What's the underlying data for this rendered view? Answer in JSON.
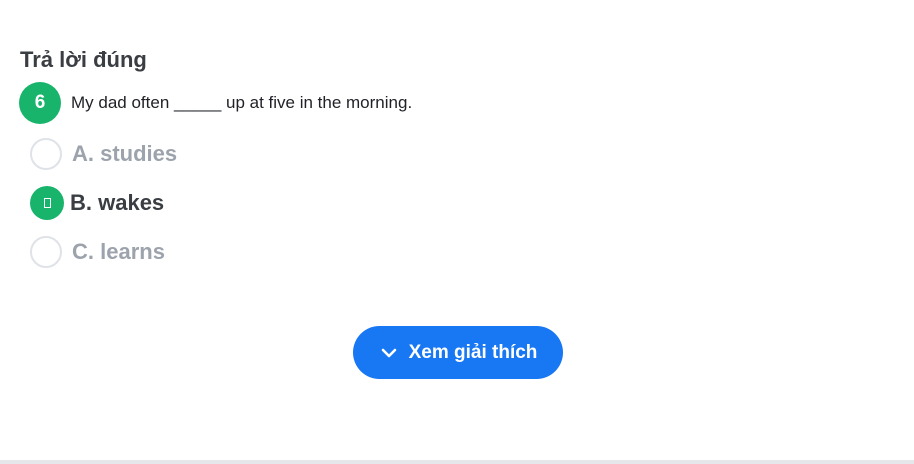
{
  "section": {
    "heading": "Trả lời đúng"
  },
  "question": {
    "number": "6",
    "text": "My dad often _____ up at five in the morning."
  },
  "options": [
    {
      "label": "A. studies",
      "state": "unselected"
    },
    {
      "label": "B. wakes",
      "state": "correct"
    },
    {
      "label": "C. learns",
      "state": "unselected"
    }
  ],
  "explain_button": {
    "label": "Xem giải thích",
    "icon": "chevron-down-icon"
  },
  "colors": {
    "correct_green": "#18b46b",
    "button_blue": "#1877f2",
    "muted_text": "#9da3ad",
    "dark_text": "#3a3d42"
  }
}
